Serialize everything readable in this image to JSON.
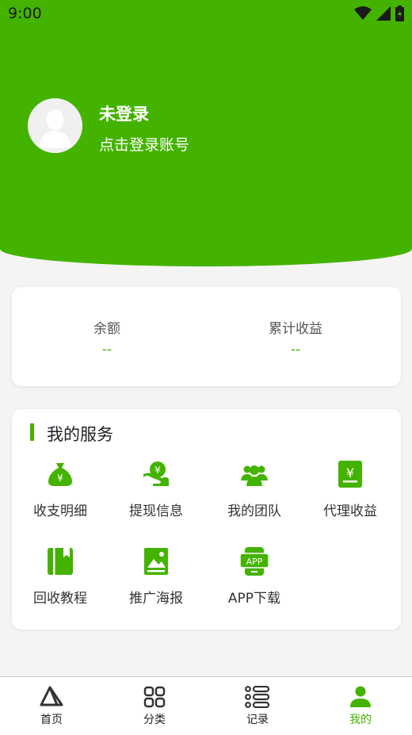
{
  "status_bar": {
    "time": "9:00"
  },
  "profile": {
    "name": "未登录",
    "subtitle": "点击登录账号"
  },
  "balance": {
    "items": [
      {
        "label": "余额",
        "value": "--"
      },
      {
        "label": "累计收益",
        "value": "--"
      }
    ]
  },
  "services": {
    "title": "我的服务",
    "items": [
      {
        "label": "收支明细",
        "icon": "money-bag-icon"
      },
      {
        "label": "提现信息",
        "icon": "hand-coin-icon"
      },
      {
        "label": "我的团队",
        "icon": "team-icon"
      },
      {
        "label": "代理收益",
        "icon": "yen-document-icon"
      },
      {
        "label": "回收教程",
        "icon": "book-icon"
      },
      {
        "label": "推广海报",
        "icon": "poster-image-icon"
      },
      {
        "label": "APP下载",
        "icon": "app-phone-icon",
        "badge": "APP"
      }
    ]
  },
  "tabbar": {
    "items": [
      {
        "label": "首页",
        "icon": "home-triangle-icon"
      },
      {
        "label": "分类",
        "icon": "category-grid-icon"
      },
      {
        "label": "记录",
        "icon": "list-icon"
      },
      {
        "label": "我的",
        "icon": "person-icon",
        "active": true
      }
    ]
  },
  "colors": {
    "accent": "#44b300",
    "background": "#f4f4f4",
    "card": "#ffffff"
  }
}
